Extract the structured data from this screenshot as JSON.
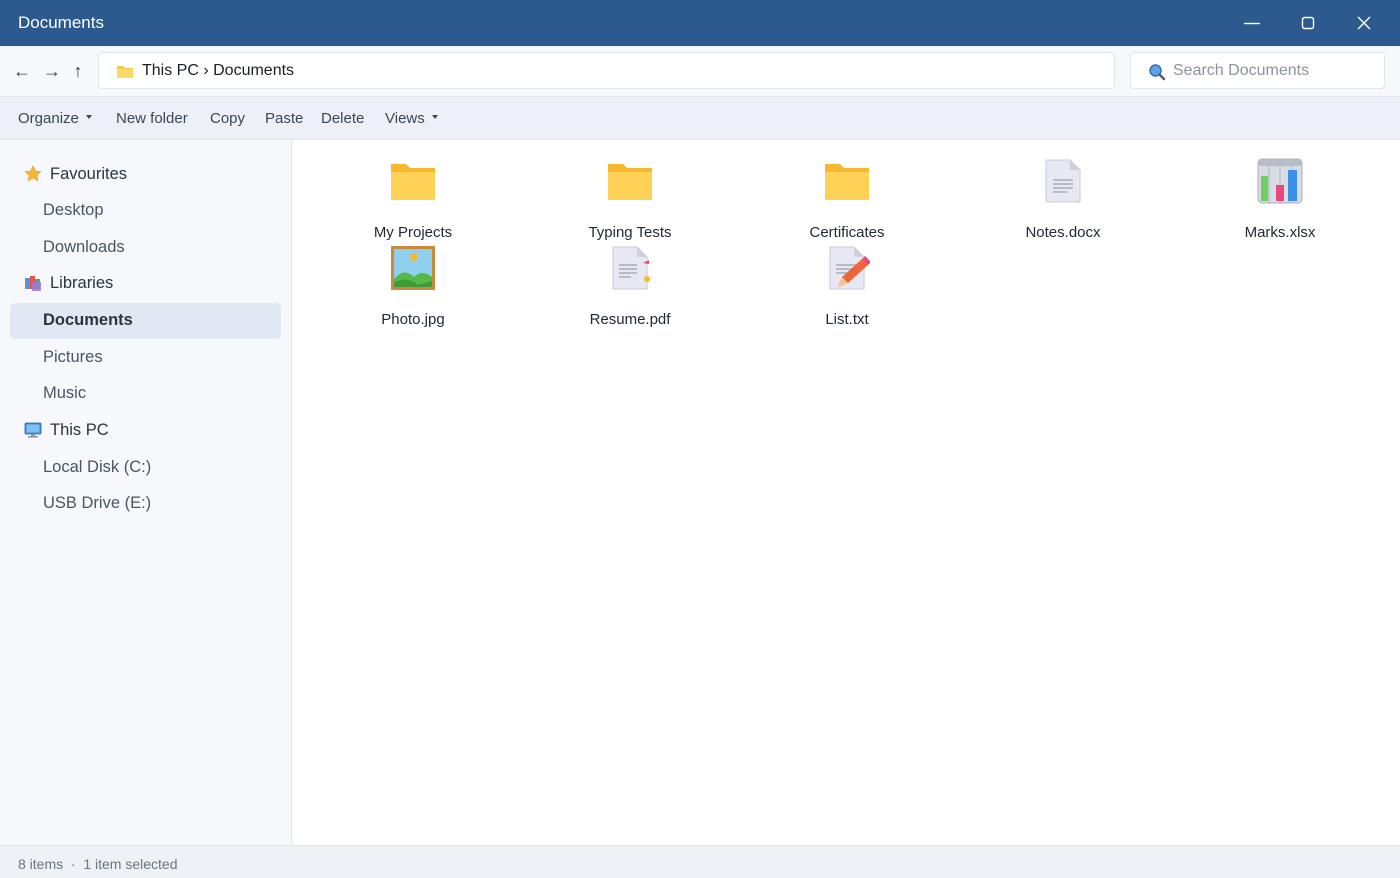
{
  "window": {
    "title": "Documents",
    "titlebar_color": "#2c5a8e"
  },
  "nav": {
    "back": "←",
    "forward": "→",
    "up": "↑"
  },
  "address": {
    "path": "This PC › Documents"
  },
  "search": {
    "placeholder": "Search Documents"
  },
  "toolbar": {
    "organize": "Organize",
    "new_folder": "New folder",
    "copy": "Copy",
    "paste": "Paste",
    "delete": "Delete",
    "views": "Views"
  },
  "sidebar": {
    "favourites": "Favourites",
    "desktop": "Desktop",
    "downloads": "Downloads",
    "libraries": "Libraries",
    "documents": "Documents",
    "pictures": "Pictures",
    "music": "Music",
    "this_pc": "This PC",
    "local_disk": "Local Disk (C:)",
    "usb_drive": "USB Drive (E:)",
    "selected": "Documents"
  },
  "files": [
    {
      "name": "My Projects",
      "icon": "folder-icon"
    },
    {
      "name": "Typing Tests",
      "icon": "folder-icon"
    },
    {
      "name": "Certificates",
      "icon": "folder-icon"
    },
    {
      "name": "Notes.docx",
      "icon": "document-icon"
    },
    {
      "name": "Marks.xlsx",
      "icon": "spreadsheet-icon"
    },
    {
      "name": "Photo.jpg",
      "icon": "image-icon"
    },
    {
      "name": "Resume.pdf",
      "icon": "pdf-icon"
    },
    {
      "name": "List.txt",
      "icon": "text-file-icon"
    }
  ],
  "status": {
    "text": "8 items  ·  1 item selected"
  }
}
